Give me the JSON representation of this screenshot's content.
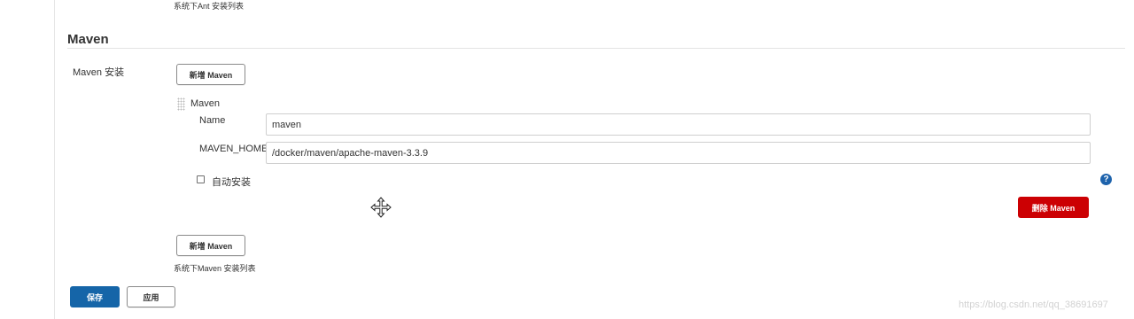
{
  "top_note": "系统下Ant 安装列表",
  "section": {
    "title": "Maven",
    "field_label": "Maven 安装",
    "add_button_label": "新增 Maven",
    "installation": {
      "title": "Maven",
      "name_label": "Name",
      "name_value": "maven",
      "home_label": "MAVEN_HOME",
      "home_value": "/docker/maven/apache-maven-3.3.9",
      "auto_install_label": "自动安装",
      "auto_install_checked": false,
      "delete_button_label": "删除 Maven"
    },
    "add_button_bottom_label": "新增 Maven",
    "list_note": "系统下Maven 安装列表"
  },
  "help_icon": {
    "glyph": "?",
    "name": "help-icon",
    "color": "#1e63ac"
  },
  "cursor": {
    "name": "move-cursor-icon"
  },
  "actions": {
    "save_label": "保存",
    "apply_label": "应用"
  },
  "watermark": "https://blog.csdn.net/qq_38691697",
  "colors": {
    "primary": "#1565a8",
    "danger": "#cc0003",
    "border": "#cfcfcf"
  }
}
